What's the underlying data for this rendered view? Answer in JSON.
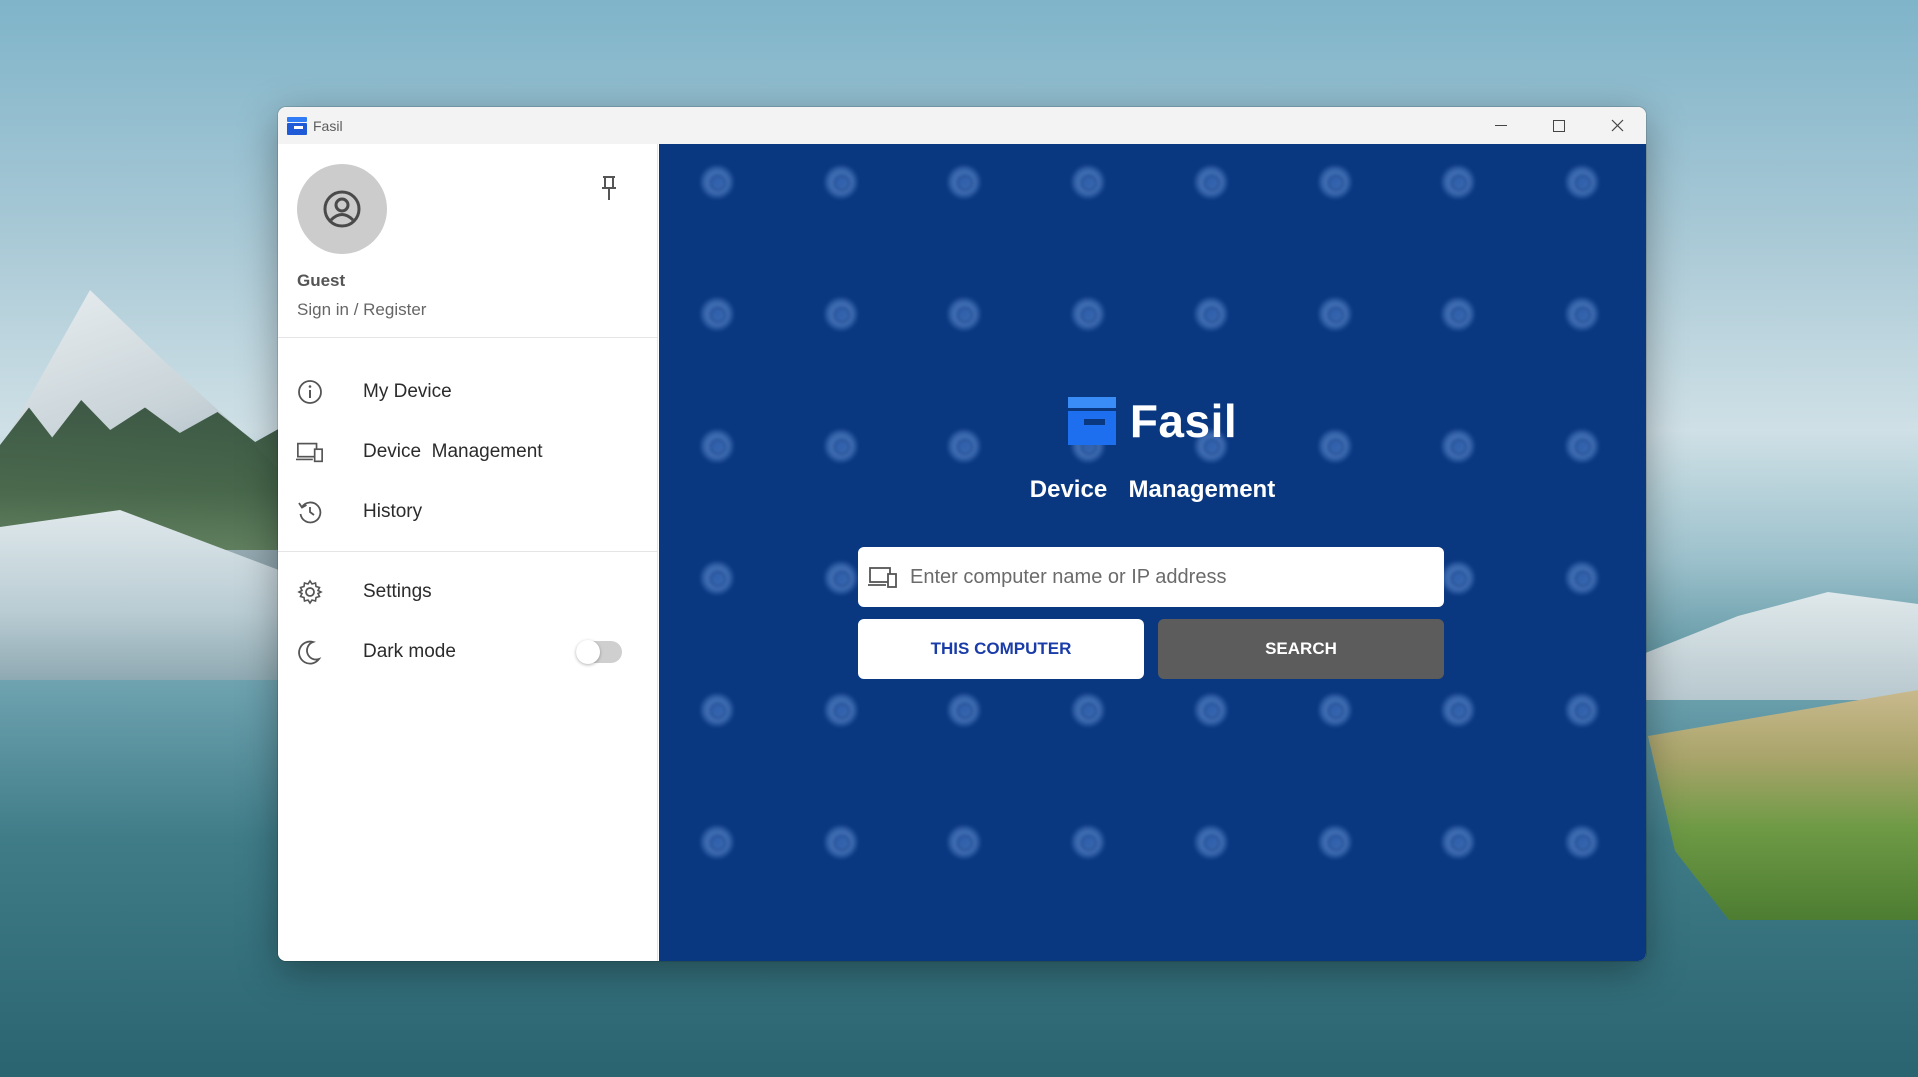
{
  "window": {
    "title": "Fasil"
  },
  "sidebar": {
    "user": {
      "name": "Guest",
      "signin_label": "Sign in / Register"
    },
    "items": [
      {
        "label": "My Device",
        "icon": "info-icon"
      },
      {
        "label": "Device  Management",
        "icon": "devices-icon"
      },
      {
        "label": "History",
        "icon": "history-icon"
      },
      {
        "label": "Settings",
        "icon": "gear-icon"
      },
      {
        "label": "Dark mode",
        "icon": "moon-icon"
      }
    ],
    "dark_mode_on": false
  },
  "main": {
    "brand_name": "Fasil",
    "subtitle": "Device  Management",
    "search_placeholder": "Enter computer name or IP address",
    "this_computer_label": "THIS COMPUTER",
    "search_label": "SEARCH",
    "background_color": "#0a3880",
    "search_button_color": "#5c5c5c"
  }
}
